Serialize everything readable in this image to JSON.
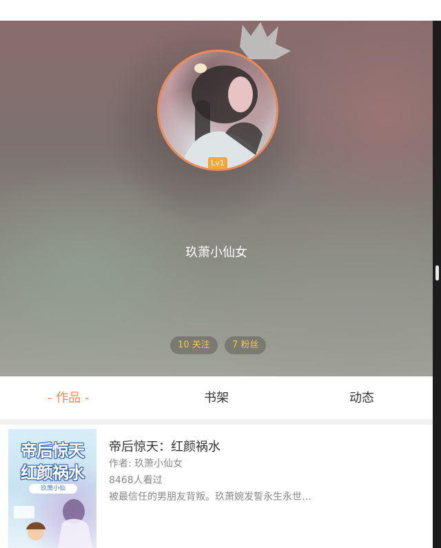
{
  "profile": {
    "level": "Lv1",
    "username": "玖萧小仙女",
    "stats": {
      "follow": "10 关注",
      "fans": "7 粉丝"
    }
  },
  "tabs": [
    {
      "label": "- 作品 -",
      "active": true
    },
    {
      "label": "书架",
      "active": false
    },
    {
      "label": "动态",
      "active": false
    }
  ],
  "books": [
    {
      "title": "帝后惊天：红颜祸水",
      "author": "作者: 玖萧小仙女",
      "views": "8468人看过",
      "description": "被最信任的男朋友背叛。玖萧婉发誓永生永世…",
      "cover": {
        "line1": "帝后惊天",
        "line2": "红颜祸水",
        "author": "玖萧小仙"
      }
    }
  ],
  "colors": {
    "accent": "#ee8a4c",
    "avatar_ring": "#ec8b58",
    "level_badge": "#f0a83a",
    "stat_text": "#f3c94a"
  }
}
